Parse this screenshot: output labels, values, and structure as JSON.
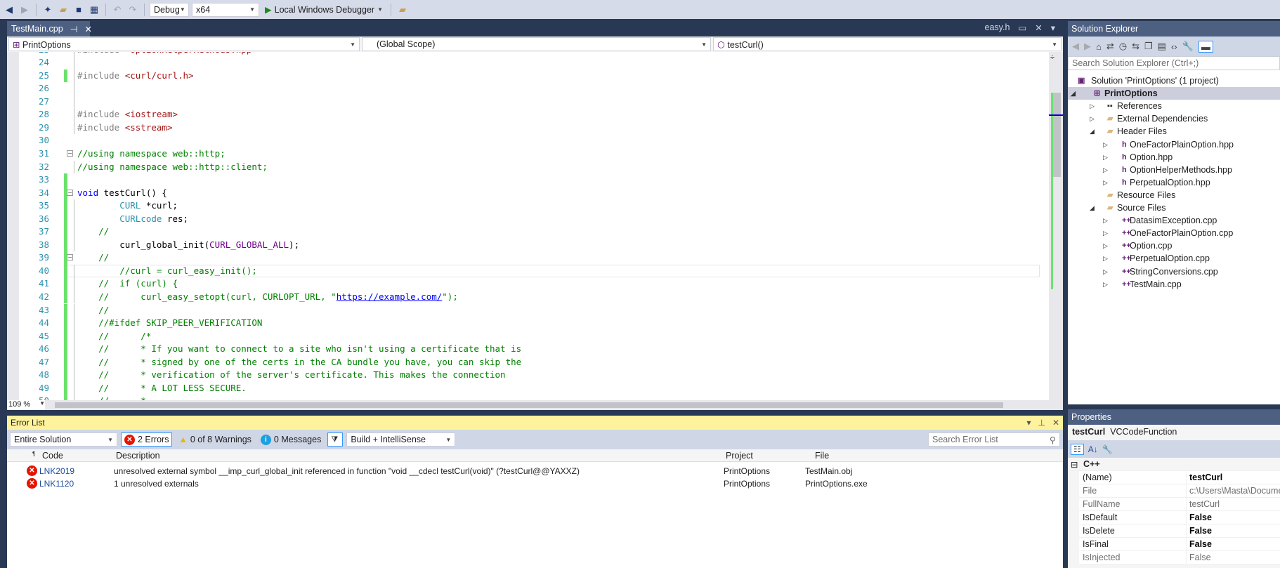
{
  "toolbar": {
    "config": "Debug",
    "platform": "x64",
    "debugger": "Local Windows Debugger"
  },
  "tabs": {
    "active": "TestMain.cpp",
    "preview": "easy.h"
  },
  "navbar": {
    "project": "PrintOptions",
    "scope": "(Global Scope)",
    "member": "testCurl()"
  },
  "editor": {
    "zoom": "109 %",
    "current_line": 40,
    "lines": [
      {
        "n": "23",
        "chg": false,
        "t": [
          [
            "pp",
            "#include "
          ],
          [
            "str",
            "\"OptionHelperMethods.hpp\""
          ]
        ]
      },
      {
        "n": "24",
        "chg": false,
        "t": []
      },
      {
        "n": "25",
        "chg": true,
        "t": [
          [
            "pp",
            "#include "
          ],
          [
            "str",
            "<curl/curl.h>"
          ]
        ]
      },
      {
        "n": "26",
        "chg": false,
        "t": []
      },
      {
        "n": "27",
        "chg": false,
        "t": []
      },
      {
        "n": "28",
        "chg": false,
        "t": [
          [
            "pp",
            "#include "
          ],
          [
            "str",
            "<iostream>"
          ]
        ]
      },
      {
        "n": "29",
        "chg": false,
        "t": [
          [
            "pp",
            "#include "
          ],
          [
            "str",
            "<sstream>"
          ]
        ]
      },
      {
        "n": "30",
        "chg": false,
        "t": []
      },
      {
        "n": "31",
        "chg": false,
        "fold": true,
        "t": [
          [
            "cm",
            "//using namespace web::http;"
          ]
        ]
      },
      {
        "n": "32",
        "chg": false,
        "t": [
          [
            "cm",
            "//using namespace web::http::client;"
          ]
        ]
      },
      {
        "n": "33",
        "chg": true,
        "t": []
      },
      {
        "n": "34",
        "chg": true,
        "fold": true,
        "t": [
          [
            "kw",
            "void"
          ],
          [
            "pl",
            " testCurl() {"
          ]
        ]
      },
      {
        "n": "35",
        "chg": true,
        "t": [
          [
            "pl",
            "        "
          ],
          [
            "ty",
            "CURL"
          ],
          [
            "pl",
            " *curl;"
          ]
        ]
      },
      {
        "n": "36",
        "chg": true,
        "t": [
          [
            "pl",
            "        "
          ],
          [
            "ty",
            "CURLcode"
          ],
          [
            "pl",
            " res;"
          ]
        ]
      },
      {
        "n": "37",
        "chg": true,
        "t": [
          [
            "cm",
            "    //"
          ]
        ]
      },
      {
        "n": "38",
        "chg": true,
        "t": [
          [
            "pl",
            "        curl_global_init("
          ],
          [
            "mac",
            "CURL_GLOBAL_ALL"
          ],
          [
            "pl",
            ");"
          ]
        ]
      },
      {
        "n": "39",
        "chg": true,
        "fold": true,
        "t": [
          [
            "cm",
            "    //"
          ]
        ]
      },
      {
        "n": "40",
        "chg": true,
        "t": [
          [
            "cm",
            "        //curl = curl_easy_init();"
          ]
        ]
      },
      {
        "n": "41",
        "chg": true,
        "t": [
          [
            "cm",
            "    //  if (curl) {"
          ]
        ]
      },
      {
        "n": "42",
        "chg": true,
        "t": [
          [
            "cm",
            "    //      curl_easy_setopt(curl, CURLOPT_URL, \""
          ],
          [
            "link",
            "https://example.com/"
          ],
          [
            "cm",
            "\");"
          ]
        ]
      },
      {
        "n": "43",
        "chg": true,
        "t": [
          [
            "cm",
            "    //"
          ]
        ]
      },
      {
        "n": "44",
        "chg": true,
        "t": [
          [
            "cm",
            "    //#ifdef SKIP_PEER_VERIFICATION"
          ]
        ]
      },
      {
        "n": "45",
        "chg": true,
        "t": [
          [
            "cm",
            "    //      /*"
          ]
        ]
      },
      {
        "n": "46",
        "chg": true,
        "t": [
          [
            "cm",
            "    //      * If you want to connect to a site who isn't using a certificate that is"
          ]
        ]
      },
      {
        "n": "47",
        "chg": true,
        "t": [
          [
            "cm",
            "    //      * signed by one of the certs in the CA bundle you have, you can skip the"
          ]
        ]
      },
      {
        "n": "48",
        "chg": true,
        "t": [
          [
            "cm",
            "    //      * verification of the server's certificate. This makes the connection"
          ]
        ]
      },
      {
        "n": "49",
        "chg": true,
        "t": [
          [
            "cm",
            "    //      * A LOT LESS SECURE."
          ]
        ]
      },
      {
        "n": "50",
        "chg": true,
        "t": [
          [
            "cm",
            "    //      *"
          ]
        ]
      }
    ]
  },
  "error_list": {
    "title": "Error List",
    "scope": "Entire Solution",
    "errors": "2 Errors",
    "warnings": "0 of 8 Warnings",
    "messages": "0 Messages",
    "source": "Build + IntelliSense",
    "search_placeholder": "Search Error List",
    "columns": {
      "code": "Code",
      "description": "Description",
      "project": "Project",
      "file": "File"
    },
    "rows": [
      {
        "code": "LNK2019",
        "description": "unresolved external symbol __imp_curl_global_init referenced in function \"void __cdecl testCurl(void)\" (?testCurl@@YAXXZ)",
        "project": "PrintOptions",
        "file": "TestMain.obj"
      },
      {
        "code": "LNK1120",
        "description": "1 unresolved externals",
        "project": "PrintOptions",
        "file": "PrintOptions.exe"
      }
    ]
  },
  "solution_explorer": {
    "title": "Solution Explorer",
    "search_placeholder": "Search Solution Explorer (Ctrl+;)",
    "items": [
      {
        "label": "Solution 'PrintOptions' (1 project)",
        "level": 0,
        "exp": "",
        "icon": "solution"
      },
      {
        "label": "PrintOptions",
        "level": 1,
        "exp": "open",
        "icon": "project",
        "sel": true
      },
      {
        "label": "References",
        "level": 2,
        "exp": "closed",
        "icon": "references"
      },
      {
        "label": "External Dependencies",
        "level": 2,
        "exp": "closed",
        "icon": "folder"
      },
      {
        "label": "Header Files",
        "level": 2,
        "exp": "open",
        "icon": "folder"
      },
      {
        "label": "OneFactorPlainOption.hpp",
        "level": 3,
        "exp": "closed",
        "icon": "header"
      },
      {
        "label": "Option.hpp",
        "level": 3,
        "exp": "closed",
        "icon": "header"
      },
      {
        "label": "OptionHelperMethods.hpp",
        "level": 3,
        "exp": "closed",
        "icon": "header"
      },
      {
        "label": "PerpetualOption.hpp",
        "level": 3,
        "exp": "closed",
        "icon": "header"
      },
      {
        "label": "Resource Files",
        "level": 2,
        "exp": "",
        "icon": "folder"
      },
      {
        "label": "Source Files",
        "level": 2,
        "exp": "open",
        "icon": "folder"
      },
      {
        "label": "DatasimException.cpp",
        "level": 3,
        "exp": "closed",
        "icon": "cpp"
      },
      {
        "label": "OneFactorPlainOption.cpp",
        "level": 3,
        "exp": "closed",
        "icon": "cpp"
      },
      {
        "label": "Option.cpp",
        "level": 3,
        "exp": "closed",
        "icon": "cpp"
      },
      {
        "label": "PerpetualOption.cpp",
        "level": 3,
        "exp": "closed",
        "icon": "cpp"
      },
      {
        "label": "StringConversions.cpp",
        "level": 3,
        "exp": "closed",
        "icon": "cpp"
      },
      {
        "label": "TestMain.cpp",
        "level": 3,
        "exp": "closed",
        "icon": "cpp"
      }
    ]
  },
  "properties": {
    "title": "Properties",
    "object_name": "testCurl",
    "object_type": "VCCodeFunction",
    "category": "C++",
    "rows": [
      {
        "name": "(Name)",
        "value": "testCurl",
        "bold": true
      },
      {
        "name": "File",
        "value": "c:\\Users\\Masta\\Documents",
        "bold": false
      },
      {
        "name": "FullName",
        "value": "testCurl",
        "bold": false
      },
      {
        "name": "IsDefault",
        "value": "False",
        "bold": true
      },
      {
        "name": "IsDelete",
        "value": "False",
        "bold": true
      },
      {
        "name": "IsFinal",
        "value": "False",
        "bold": true
      },
      {
        "name": "IsInjected",
        "value": "False",
        "bold": false
      }
    ]
  }
}
